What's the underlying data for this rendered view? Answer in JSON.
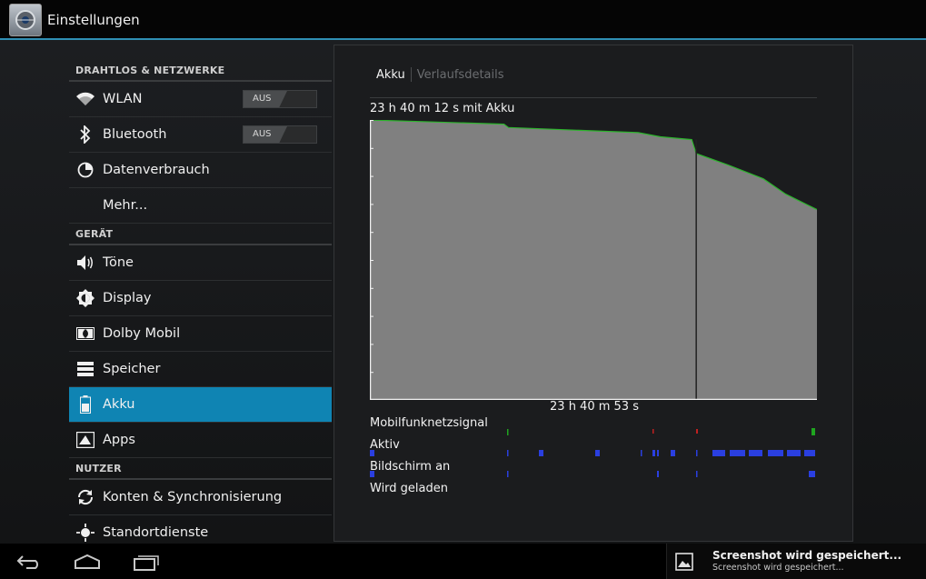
{
  "titlebar": {
    "title": "Einstellungen",
    "icon": "settings-app-icon"
  },
  "sidebar": {
    "sections": [
      {
        "header": "DRAHTLOS & NETZWERKE",
        "items": [
          {
            "label": "WLAN",
            "icon": "wifi-icon",
            "toggle": "AUS"
          },
          {
            "label": "Bluetooth",
            "icon": "bluetooth-icon",
            "toggle": "AUS"
          },
          {
            "label": "Datenverbrauch",
            "icon": "data-usage-icon"
          },
          {
            "label": "Mehr...",
            "icon": ""
          }
        ]
      },
      {
        "header": "GERÄT",
        "items": [
          {
            "label": "Töne",
            "icon": "speaker-icon"
          },
          {
            "label": "Display",
            "icon": "brightness-icon"
          },
          {
            "label": "Dolby Mobil",
            "icon": "dolby-icon"
          },
          {
            "label": "Speicher",
            "icon": "storage-icon"
          },
          {
            "label": "Akku",
            "icon": "battery-icon",
            "selected": true
          },
          {
            "label": "Apps",
            "icon": "apps-icon"
          }
        ]
      },
      {
        "header": "NUTZER",
        "items": [
          {
            "label": "Konten & Synchronisierung",
            "icon": "sync-icon"
          },
          {
            "label": "Standortdienste",
            "icon": "location-icon"
          }
        ]
      }
    ]
  },
  "battery": {
    "tabs": {
      "active": "Akku",
      "inactive": "Verlaufsdetails"
    },
    "duration_text": "23 h 40 m 12 s mit Akku",
    "chart_time_text": "23 h 40 m 53 s",
    "labels": {
      "signal": "Mobilfunknetzsignal",
      "awake": "Aktiv",
      "screen": "Bildschirm an",
      "charging": "Wird geladen"
    },
    "colors": {
      "fill": "#808080",
      "line": "#2db52d",
      "awake": "#2a3fe0",
      "signal_good": "#1fa51f",
      "signal_bad": "#c02020"
    }
  },
  "chart_data": {
    "type": "area",
    "series": [
      {
        "values_pct_over_time": [
          [
            0,
            100
          ],
          [
            0.3,
            98.5
          ],
          [
            0.31,
            97.3
          ],
          [
            0.6,
            95.5
          ],
          [
            0.65,
            94.0
          ],
          [
            0.72,
            93.0
          ],
          [
            0.73,
            88.0
          ],
          [
            0.8,
            84.0
          ],
          [
            0.88,
            79.0
          ],
          [
            0.93,
            73.5
          ],
          [
            1.0,
            68.0
          ]
        ]
      }
    ],
    "xlim": [
      0,
      1
    ],
    "ylim": [
      0,
      100
    ],
    "grid": false
  },
  "navbar": {
    "back": "back-icon",
    "home": "home-icon",
    "recents": "recents-icon"
  },
  "notification": {
    "title": "Screenshot wird gespeichert...",
    "subtitle": "Screenshot wird gespeichert..."
  }
}
